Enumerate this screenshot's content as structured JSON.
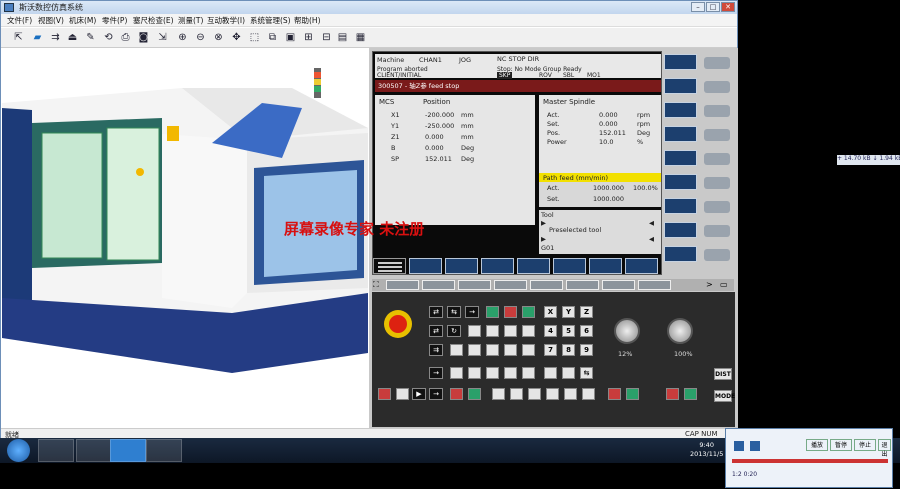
{
  "window": {
    "title": "斯沃数控仿真系统",
    "min": "–",
    "max": "□",
    "close": "✕"
  },
  "menu": [
    "文件(F)",
    "视图(V)",
    "机床(M)",
    "零件(P)",
    "塞尺检查(E)",
    "测量(T)",
    "互动教学(I)",
    "系统管理(S)",
    "帮助(H)"
  ],
  "toolbar_icons": [
    "reset-icon",
    "open-icon",
    "save-icon",
    "measure-icon",
    "tool-icon",
    "view-icon",
    "print-icon",
    "camera-icon",
    "zoom-icon",
    "zoom-in-icon",
    "zoom-out-icon",
    "rotate-icon",
    "pan-icon",
    "front-icon",
    "side-icon",
    "top-icon",
    "screen-icon",
    "grid-icon"
  ],
  "statusbar": {
    "left": "就绪",
    "right": "CAP NUM"
  },
  "cnc": {
    "header": {
      "machine": "Machine",
      "chan": "CHAN1",
      "mode": "JOG",
      "status": "NC STOP DIR",
      "program_label": "Program aborted",
      "slot_info": "Chan reset",
      "chan_status": "Stop: No Mode Group Ready",
      "prog_name": "CLIENT/INITIAL",
      "tabs": [
        "SKP",
        "",
        "ROV",
        "SBL",
        "MO1"
      ]
    },
    "alarm": "300507 - 轴Z参 feed stop",
    "mcs": {
      "title": "MCS",
      "position_label": "Position",
      "axes": [
        {
          "name": "X1",
          "value": "-200.000",
          "unit": "mm"
        },
        {
          "name": "Y1",
          "value": "-250.000",
          "unit": "mm"
        },
        {
          "name": "Z1",
          "value": "0.000",
          "unit": "mm"
        },
        {
          "name": "B",
          "value": "0.000",
          "unit": "Deg"
        },
        {
          "name": "SP",
          "value": "152.011",
          "unit": "Deg"
        }
      ]
    },
    "spindle": {
      "title": "Master Spindle",
      "rows": [
        {
          "label": "Act.",
          "value": "0.000",
          "unit": "rpm"
        },
        {
          "label": "Set.",
          "value": "0.000",
          "unit": "rpm"
        },
        {
          "label": "Pos.",
          "value": "152.011",
          "unit": "Deg"
        },
        {
          "label": "Power",
          "value": "10.0",
          "unit": "%"
        }
      ]
    },
    "feed": {
      "title": "Path feed (mm/min)",
      "act_label": "Act.",
      "act_value": "1000.000",
      "act_pct": "100.0%",
      "set_label": "Set.",
      "set_value": "1000.000"
    },
    "tool": {
      "title": "Tool",
      "preselected": "Preselected tool",
      "g_code": "G01"
    },
    "right_softkeys": [
      "",
      "",
      "",
      "",
      "",
      "",
      "",
      "",
      ""
    ],
    "bottom_softkeys": [
      "",
      "",
      "",
      "",
      "",
      "",
      "",
      "",
      ""
    ],
    "keypad": {
      "letters": [
        "X",
        "Y",
        "Z"
      ],
      "nums": [
        "4",
        "5",
        "6",
        "7",
        "8",
        "9"
      ],
      "mode_labels": [
        "DIST",
        "MODE"
      ]
    },
    "kn1_label": "12%",
    "kn2_label": "100%"
  },
  "watermark": "屏幕录像专家 未注册",
  "taskbar": {
    "time": "9:40",
    "date": "2013/11/5"
  },
  "helper": {
    "buttons": [
      "播放",
      "暂停",
      "停止",
      "退出"
    ],
    "time_label": "0:2 1:20 ",
    "elapsed": "1:2 0:20"
  },
  "side_info": "+ 14.70 kB   ↓ 1.94 kB"
}
